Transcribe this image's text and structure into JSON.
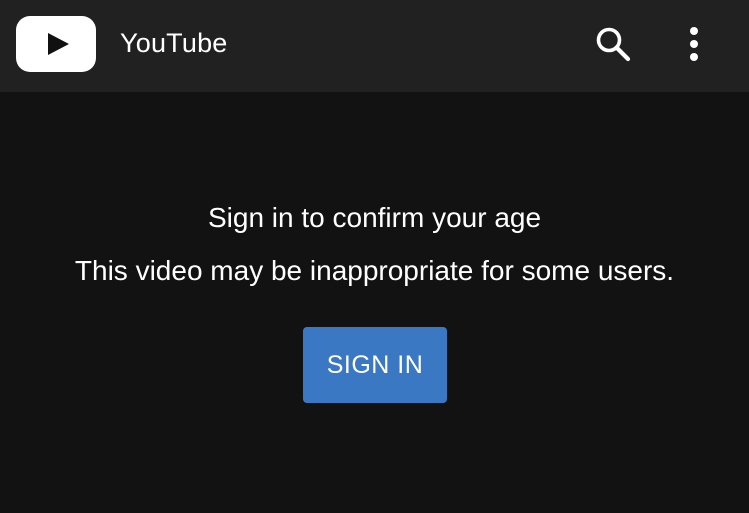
{
  "header": {
    "title": "YouTube",
    "logo_icon": "youtube-play-logo-icon",
    "search_icon": "search-icon",
    "menu_icon": "more-vertical-icon",
    "background_color": "#212121"
  },
  "main": {
    "heading": "Sign in to confirm your age",
    "message": "This video may be inappropriate for some users.",
    "sign_in_label": "SIGN IN",
    "background_color": "#121212"
  },
  "colors": {
    "accent": "#3a78c4",
    "text": "#ffffff"
  }
}
